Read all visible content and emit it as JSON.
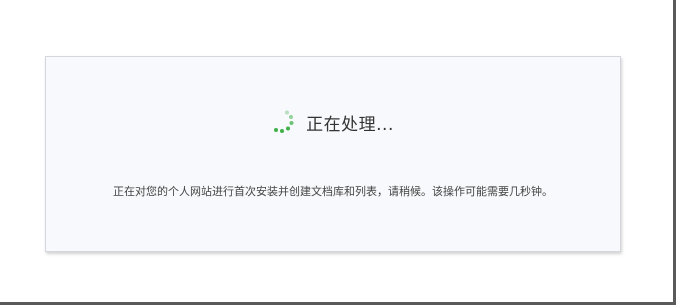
{
  "dialog": {
    "status_text": "正在处理...",
    "message": "正在对您的个人网站进行首次安装并创建文档库和列表，请稍候。该操作可能需要几秒钟。",
    "spinner_icon": "loading-spinner-icon",
    "accent_color": "#3fb04a"
  }
}
